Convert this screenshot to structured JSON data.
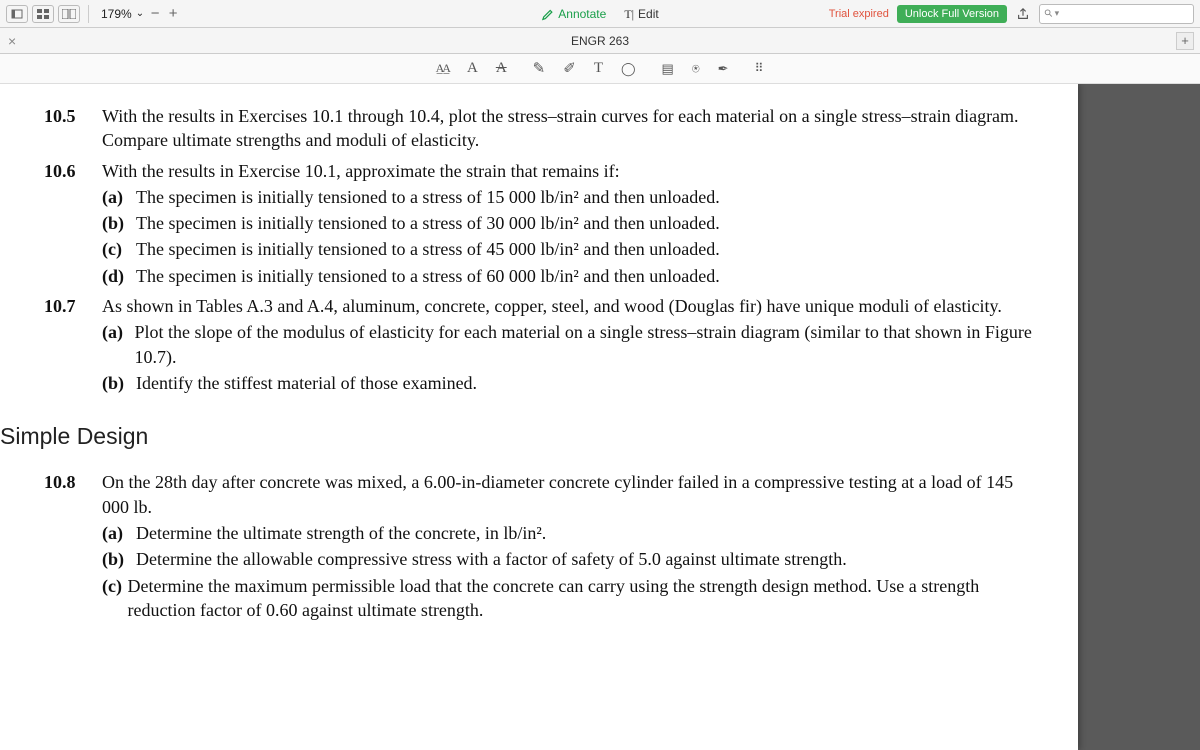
{
  "top": {
    "zoom": "179%",
    "zoom_arrow": "⌄",
    "minus": "−",
    "plus": "+",
    "annotate": "Annotate",
    "edit": "Edit",
    "trial": "Trial expired",
    "unlock": "Unlock Full Version",
    "search_placeholder": ""
  },
  "tab": {
    "title": "ENGR 263",
    "close": "×",
    "add": "+"
  },
  "tools": {
    "aA": "A̲A̲",
    "A1": "A",
    "A2": "A",
    "pencil1": "✎",
    "pencil2": "✐",
    "T": "T",
    "lasso": "◯",
    "note": "▤",
    "stamp": "⍟",
    "sign": "✒",
    "grid": "⠿"
  },
  "sidebar_hint": "▍",
  "doc": {
    "p105_num": "10.5",
    "p105_text": "With the results in Exercises 10.1 through 10.4, plot the stress–strain curves for each material on a single stress–strain diagram. Compare ultimate strengths and moduli of elasticity.",
    "p106_num": "10.6",
    "p106_text": "With the results in Exercise 10.1, approximate the strain that remains if:",
    "p106_a_lbl": "(a)",
    "p106_a": "The specimen is initially tensioned to a stress of 15 000 lb/in² and then unloaded.",
    "p106_b_lbl": "(b)",
    "p106_b": "The specimen is initially tensioned to a stress of 30 000 lb/in² and then unloaded.",
    "p106_c_lbl": "(c)",
    "p106_c": "The specimen is initially tensioned to a stress of 45 000 lb/in² and then unloaded.",
    "p106_d_lbl": "(d)",
    "p106_d": "The specimen is initially tensioned to a stress of 60 000 lb/in² and then unloaded.",
    "p107_num": "10.7",
    "p107_text": "As shown in Tables A.3 and A.4, aluminum, concrete, copper, steel, and wood (Douglas fir) have unique moduli of elasticity.",
    "p107_a_lbl": "(a)",
    "p107_a": "Plot the slope of the modulus of elasticity for each material on a single stress–strain diagram (similar to that shown in Figure 10.7).",
    "p107_b_lbl": "(b)",
    "p107_b": "Identify the stiffest material of those examined.",
    "section": "Simple Design",
    "p108_num": "10.8",
    "p108_text": "On the 28th day after concrete was mixed, a 6.00-in-diameter concrete cylinder failed in a compressive testing at a load of 145 000 lb.",
    "p108_a_lbl": "(a)",
    "p108_a": "Determine the ultimate strength of the concrete, in lb/in².",
    "p108_b_lbl": "(b)",
    "p108_b": "Determine the allowable compressive stress with a factor of safety of 5.0 against ultimate strength.",
    "p108_c_lbl": "(c)",
    "p108_c": "Determine the maximum permissible load that the concrete can carry using the strength design method. Use a strength reduction factor of 0.60 against ultimate strength."
  }
}
